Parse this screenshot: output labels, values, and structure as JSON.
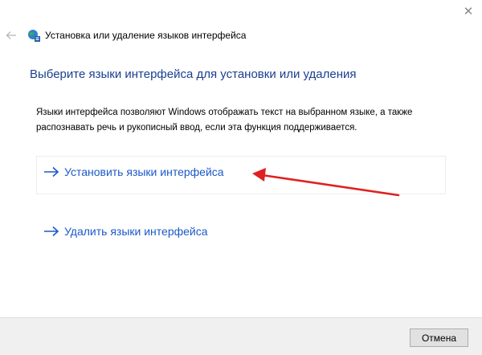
{
  "window": {
    "title": "Установка или удаление языков интерфейса",
    "close_icon": "close-icon",
    "back_icon": "back-arrow-icon",
    "app_icon": "globe-icon"
  },
  "main": {
    "heading": "Выберите языки интерфейса для установки или удаления",
    "description": "Языки интерфейса позволяют Windows отображать текст на выбранном языке, а также распознавать речь и рукописный ввод, если эта функция поддерживается.",
    "commands": [
      {
        "label": "Установить языки интерфейса",
        "icon": "arrow-right-icon"
      },
      {
        "label": "Удалить языки интерфейса",
        "icon": "arrow-right-icon"
      }
    ]
  },
  "annotation": {
    "color": "#e02020",
    "points_to": "Установить языки интерфейса"
  },
  "footer": {
    "cancel_label": "Отмена"
  },
  "colors": {
    "heading": "#1a3f8f",
    "link": "#1b59c9",
    "footer_bg": "#f0f0f0"
  }
}
